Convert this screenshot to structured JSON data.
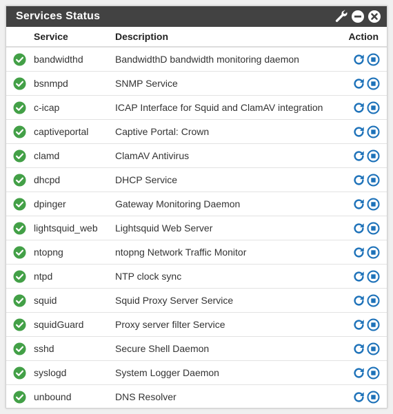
{
  "widget": {
    "title": "Services Status",
    "controls": [
      {
        "icon": "wrench-icon"
      },
      {
        "icon": "minimize-icon"
      },
      {
        "icon": "close-icon"
      }
    ]
  },
  "table": {
    "headers": {
      "service": "Service",
      "description": "Description",
      "action": "Action"
    },
    "rows": [
      {
        "service": "bandwidthd",
        "description": "BandwidthD bandwidth monitoring daemon",
        "status": "running"
      },
      {
        "service": "bsnmpd",
        "description": "SNMP Service",
        "status": "running"
      },
      {
        "service": "c-icap",
        "description": "ICAP Interface for Squid and ClamAV integration",
        "status": "running"
      },
      {
        "service": "captiveportal",
        "description": "Captive Portal: Crown",
        "status": "running"
      },
      {
        "service": "clamd",
        "description": "ClamAV Antivirus",
        "status": "running"
      },
      {
        "service": "dhcpd",
        "description": "DHCP Service",
        "status": "running"
      },
      {
        "service": "dpinger",
        "description": "Gateway Monitoring Daemon",
        "status": "running"
      },
      {
        "service": "lightsquid_web",
        "description": "Lightsquid Web Server",
        "status": "running"
      },
      {
        "service": "ntopng",
        "description": "ntopng Network Traffic Monitor",
        "status": "running"
      },
      {
        "service": "ntpd",
        "description": "NTP clock sync",
        "status": "running"
      },
      {
        "service": "squid",
        "description": "Squid Proxy Server Service",
        "status": "running"
      },
      {
        "service": "squidGuard",
        "description": "Proxy server filter Service",
        "status": "running"
      },
      {
        "service": "sshd",
        "description": "Secure Shell Daemon",
        "status": "running"
      },
      {
        "service": "syslogd",
        "description": "System Logger Daemon",
        "status": "running"
      },
      {
        "service": "unbound",
        "description": "DNS Resolver",
        "status": "running"
      }
    ],
    "row_icons": {
      "status": "check-circle-icon",
      "restart": "restart-icon",
      "stop": "stop-icon"
    }
  },
  "colors": {
    "header_bg": "#424242",
    "status_ok": "#43a047",
    "action_blue": "#1e72b9"
  }
}
